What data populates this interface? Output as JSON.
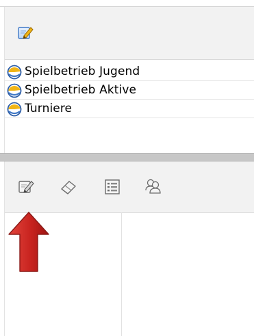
{
  "tree": {
    "items": [
      {
        "label": "Spielbetrieb Jugend",
        "icon": "season-ball-icon"
      },
      {
        "label": "Spielbetrieb Aktive",
        "icon": "season-ball-icon"
      },
      {
        "label": "Turniere",
        "icon": "season-ball-icon"
      }
    ]
  },
  "top_toolbar": {
    "edit_icon": "edit-notepad-icon"
  },
  "bottom_toolbar": {
    "icons": [
      "edit-notepad-icon",
      "eraser-icon",
      "list-view-icon",
      "users-group-icon"
    ]
  },
  "annotation": {
    "arrow_color": "#c8231f",
    "arrow_icon": "red-up-arrow-icon"
  },
  "colors": {
    "toolbar_bg": "#f2f2f2",
    "splitter": "#c7c7c7",
    "accent_blue": "#3f78c6",
    "accent_yellow": "#f1b517"
  }
}
